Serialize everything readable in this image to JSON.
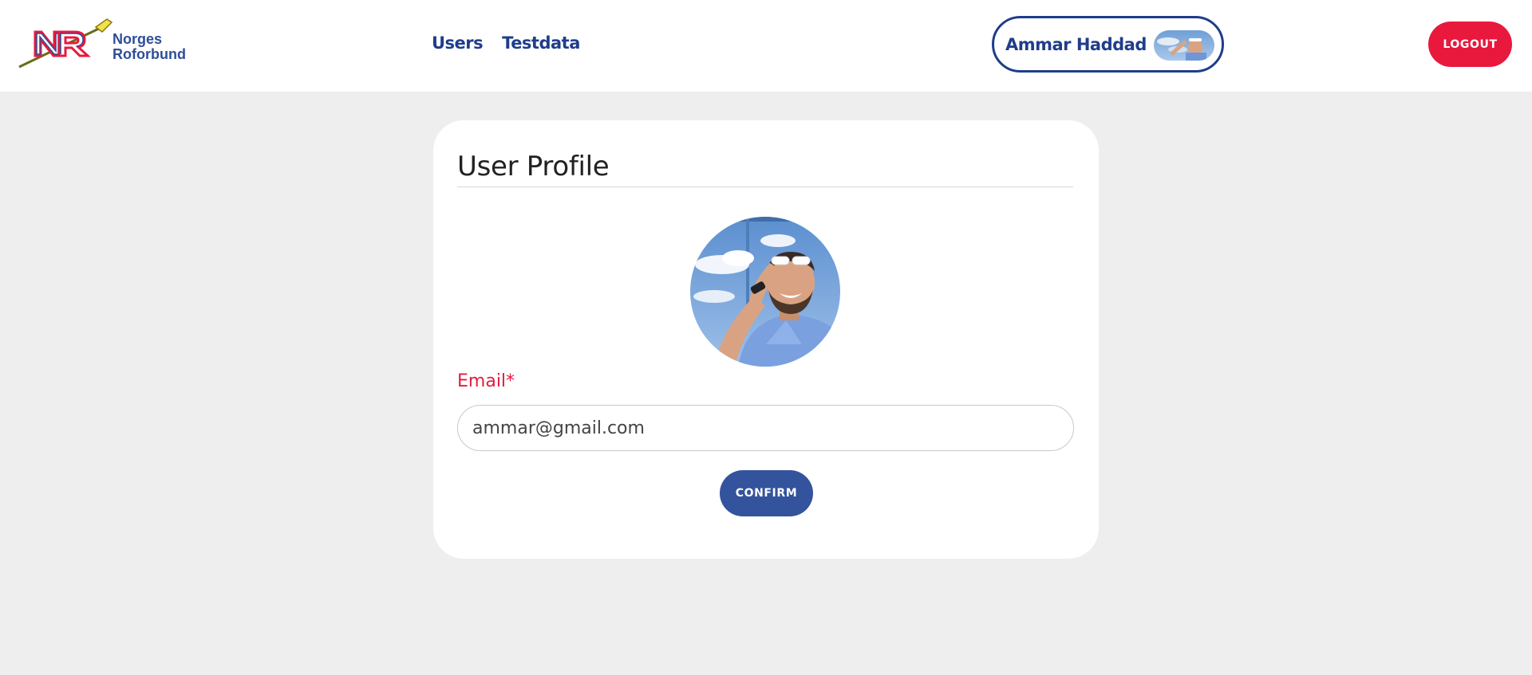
{
  "brand": {
    "logo_line1": "Norges",
    "logo_line2": "Roforbund",
    "logo_icon": "nr-oar-logo",
    "primary_color": "#1f3d8b",
    "accent_color": "#e8193c"
  },
  "nav": {
    "items": [
      {
        "label": "Users"
      },
      {
        "label": "Testdata"
      }
    ]
  },
  "user": {
    "name": "Ammar Haddad",
    "avatar_icon": "user-photo"
  },
  "header": {
    "logout_label": "LOGOUT"
  },
  "profile": {
    "title": "User Profile",
    "email_label": "Email*",
    "email_value": "ammar@gmail.com",
    "confirm_label": "CONFIRM"
  }
}
